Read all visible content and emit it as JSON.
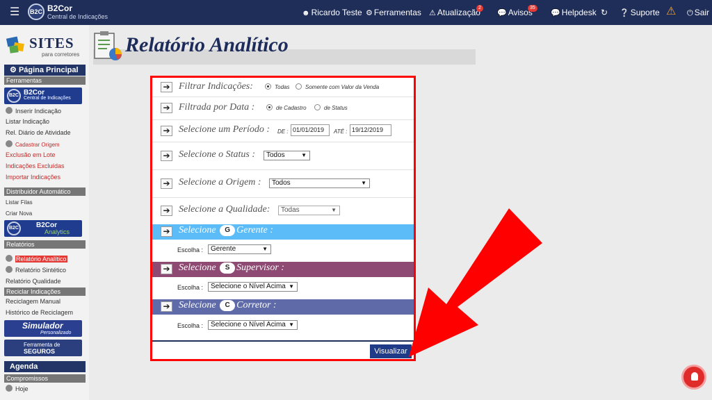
{
  "topbar": {
    "menu_icon": "hamburger-icon",
    "brand_logo": "B2C",
    "brand_title": "B2Cor",
    "brand_subtitle": "Central de Indicações",
    "user": "Ricardo Teste",
    "ferramentas": "Ferramentas",
    "atualizacao": "Atualização",
    "atualizacao_count": "2",
    "avisos": "Avisos",
    "avisos_count": "35",
    "helpdesk": "Helpdesk",
    "suporte": "Suporte",
    "sair": "Sair",
    "accent": "#1f2d59"
  },
  "sidebar": {
    "logo_title": "SITES",
    "logo_subtitle": "para corretores",
    "pagina_principal": "Página Principal",
    "ferramentas": "Ferramentas",
    "b2cor_title": "B2Cor",
    "b2cor_sub": "Central de Indicações",
    "items_ferramentas": [
      "Inserir Indicação",
      "Listar Indicação",
      "Rel. Diário de Atividade",
      "Cadastrar Origem",
      "Exclusão em Lote",
      "Indicações Excluídas",
      "Importar Indicações"
    ],
    "distribuidor": "Distribuidor Automático",
    "items_distribuidor": [
      "Listar Filas",
      "Criar Nova"
    ],
    "analytics_title": "B2Cor",
    "analytics_sub": "Analytics",
    "relatorios": "Relatórios",
    "items_relatorios": [
      "Relatório Analítico",
      "Relatório Sintético",
      "Relatório Qualidade"
    ],
    "reciclar": "Reciclar Indicações",
    "items_reciclar": [
      "Reciclagem Manual",
      "Histórico de Reciclagem"
    ],
    "simulador": "Simulador",
    "simulador_sub": "Personalizado",
    "seguros_a": "Ferramenta de",
    "seguros_b": "SEGUROS",
    "agenda": "Agenda",
    "compromissos": "Compromissos",
    "hoje": "Hoje"
  },
  "page": {
    "title": "Relatório Analítico"
  },
  "form": {
    "filtrar_label": "Filtrar Indicações:",
    "filtrar_opt1": "Todas",
    "filtrar_opt2": "Somente com Valor da Venda",
    "filtrada_label": "Filtrada por Data :",
    "filtrada_opt1": "de Cadastro",
    "filtrada_opt2": "de Status",
    "periodo_label": "Selecione um Período :",
    "de": "DE :",
    "de_value": "01/01/2019",
    "ate": "ATÉ :",
    "ate_value": "19/12/2019",
    "status_label": "Selecione o Status :",
    "status_value": "Todos",
    "origem_label": "Selecione a Origem :",
    "origem_value": "Todos",
    "qualidade_label": "Selecione a Qualidade:",
    "qualidade_value": "Todas",
    "gerente_pre": "Selecione",
    "gerente_badge": "G",
    "gerente_label": "Gerente :",
    "gerente_color": "#5bbcf7",
    "escolha": "Escolha :",
    "gerente_value": "Gerente",
    "supervisor_pre": "Selecione",
    "supervisor_badge": "S",
    "supervisor_label": "Supervisor :",
    "supervisor_color": "#8e4a73",
    "supervisor_value": "Selecione o Nível Acima",
    "corretor_pre": "Selecione",
    "corretor_badge": "C",
    "corretor_label": "Corretor :",
    "corretor_color": "#5f6aa8",
    "corretor_value": "Selecione o Nível Acima",
    "visualizar": "Visualizar",
    "highlight_color": "#ff0000"
  }
}
